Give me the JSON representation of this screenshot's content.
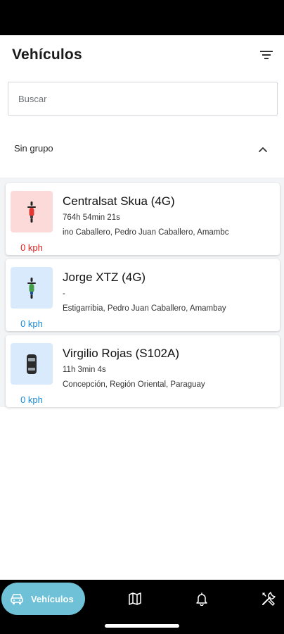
{
  "header": {
    "title": "Vehículos",
    "filter_icon": "filter-icon"
  },
  "search": {
    "placeholder": "Buscar",
    "value": ""
  },
  "group": {
    "label": "Sin grupo",
    "expanded": true,
    "toggle_icon": "chevron-up-icon"
  },
  "vehicles": [
    {
      "name": "Centralsat Skua (4G)",
      "time": "764h 54min 21s",
      "address": "ino Caballero, Pedro Juan Caballero, Amambc",
      "speed": "0 kph",
      "speed_color": "#e02020",
      "thumb_bg": "#fddada",
      "icon": "motorcycle-red-icon"
    },
    {
      "name": "Jorge XTZ (4G)",
      "time": "-",
      "address": "Estigarribia, Pedro Juan Caballero, Amambay",
      "speed": "0 kph",
      "speed_color": "#1a8ad6",
      "thumb_bg": "#d8eafb",
      "icon": "motorcycle-green-icon"
    },
    {
      "name": "Virgilio Rojas (S102A)",
      "time": "11h 3min 4s",
      "address": "Concepción, Región Oriental, Paraguay",
      "speed": "0 kph",
      "speed_color": "#1a8ad6",
      "thumb_bg": "#d8eafb",
      "icon": "car-icon"
    }
  ],
  "bottom_nav": {
    "active_label": "Vehículos",
    "items": [
      "vehicles-icon",
      "map-icon",
      "bell-icon",
      "tools-icon"
    ]
  },
  "colors": {
    "accent": "#6ec1d7",
    "moving_speed": "#e02020",
    "stopped_speed": "#1a8ad6"
  }
}
